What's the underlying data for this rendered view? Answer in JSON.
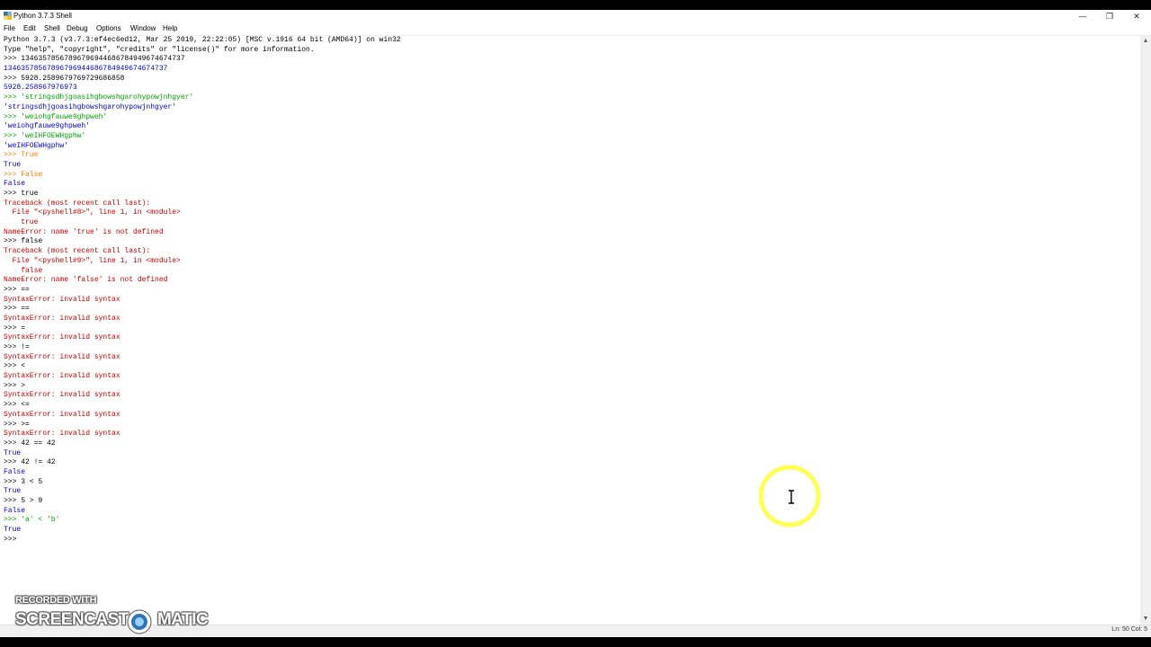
{
  "window": {
    "title": "Python 3.7.3 Shell",
    "controls": {
      "minimize": "—",
      "restore": "❐",
      "close": "✕"
    }
  },
  "menu": [
    "File",
    "Edit",
    "Shell",
    "Debug",
    "Options",
    "Window",
    "Help"
  ],
  "shell_lines": [
    {
      "text": "Python 3.7.3 (v3.7.3:ef4ec6ed12, Mar 25 2019, 22:22:05) [MSC v.1916 64 bit (AMD64)] on win32",
      "kind": "in"
    },
    {
      "text": "Type \"help\", \"copyright\", \"credits\" or \"license()\" for more information.",
      "kind": "in"
    },
    {
      "text": ">>> 13463578567896796944686784949674674737",
      "kind": "in"
    },
    {
      "text": "13463578567896796944686784949674674737",
      "kind": "out"
    },
    {
      "text": ">>> 5928.2589679769729686858",
      "kind": "in"
    },
    {
      "text": "5928.258967976973",
      "kind": "out"
    },
    {
      "text": ">>> 'stringsdhjgoasihgbowshgarohypowjnhgyer'",
      "kind": "str"
    },
    {
      "text": "'stringsdhjgoasihgbowshgarohypowjnhgyer'",
      "kind": "out"
    },
    {
      "text": ">>> 'weiohgfauwe9ghpweh'",
      "kind": "str"
    },
    {
      "text": "'weiohgfauwe9ghpweh'",
      "kind": "out"
    },
    {
      "text": ">>> 'weIHFOEWHgphw'",
      "kind": "str"
    },
    {
      "text": "'weIHFOEWHgphw'",
      "kind": "out"
    },
    {
      "text": ">>> True",
      "kind": "kw"
    },
    {
      "text": "True",
      "kind": "out"
    },
    {
      "text": ">>> False",
      "kind": "kw"
    },
    {
      "text": "False",
      "kind": "out"
    },
    {
      "text": ">>> true",
      "kind": "in"
    },
    {
      "text": "Traceback (most recent call last):",
      "kind": "err"
    },
    {
      "text": "  File \"<pyshell#8>\", line 1, in <module>",
      "kind": "err"
    },
    {
      "text": "    true",
      "kind": "err"
    },
    {
      "text": "NameError: name 'true' is not defined",
      "kind": "err"
    },
    {
      "text": ">>> false",
      "kind": "in"
    },
    {
      "text": "Traceback (most recent call last):",
      "kind": "err"
    },
    {
      "text": "  File \"<pyshell#9>\", line 1, in <module>",
      "kind": "err"
    },
    {
      "text": "    false",
      "kind": "err"
    },
    {
      "text": "NameError: name 'false' is not defined",
      "kind": "err"
    },
    {
      "text": ">>> ==",
      "kind": "in"
    },
    {
      "text": "SyntaxError: invalid syntax",
      "kind": "err"
    },
    {
      "text": ">>> ==",
      "kind": "in"
    },
    {
      "text": "SyntaxError: invalid syntax",
      "kind": "err"
    },
    {
      "text": ">>> =",
      "kind": "in"
    },
    {
      "text": "SyntaxError: invalid syntax",
      "kind": "err"
    },
    {
      "text": ">>> !=",
      "kind": "in"
    },
    {
      "text": "SyntaxError: invalid syntax",
      "kind": "err"
    },
    {
      "text": ">>> <",
      "kind": "in"
    },
    {
      "text": "SyntaxError: invalid syntax",
      "kind": "err"
    },
    {
      "text": ">>> >",
      "kind": "in"
    },
    {
      "text": "SyntaxError: invalid syntax",
      "kind": "err"
    },
    {
      "text": ">>> <=",
      "kind": "in"
    },
    {
      "text": "SyntaxError: invalid syntax",
      "kind": "err"
    },
    {
      "text": ">>> >=",
      "kind": "in"
    },
    {
      "text": "SyntaxError: invalid syntax",
      "kind": "err"
    },
    {
      "text": ">>> 42 == 42",
      "kind": "in"
    },
    {
      "text": "True",
      "kind": "out"
    },
    {
      "text": ">>> 42 != 42",
      "kind": "in"
    },
    {
      "text": "False",
      "kind": "out"
    },
    {
      "text": ">>> 3 < 5",
      "kind": "in"
    },
    {
      "text": "True",
      "kind": "out"
    },
    {
      "text": ">>> 5 > 9",
      "kind": "in"
    },
    {
      "text": "False",
      "kind": "out"
    },
    {
      "text": ">>> 'a' < 'b'",
      "kind": "str"
    },
    {
      "text": "True",
      "kind": "out"
    },
    {
      "text": ">>> ",
      "kind": "in"
    }
  ],
  "status": {
    "position": "Ln: 50   Col: 5"
  },
  "watermark": {
    "line1": "RECORDED WITH",
    "left": "SCREENCAST",
    "right": "MATIC"
  },
  "colors": {
    "output": "#0000c0",
    "error": "#c00000",
    "string": "#00a000",
    "keyword": "#ff7700",
    "cursor_highlight": "#ffff66"
  },
  "icons": {
    "app": "python-idle-icon",
    "cursor": "text-ibeam-cursor"
  }
}
